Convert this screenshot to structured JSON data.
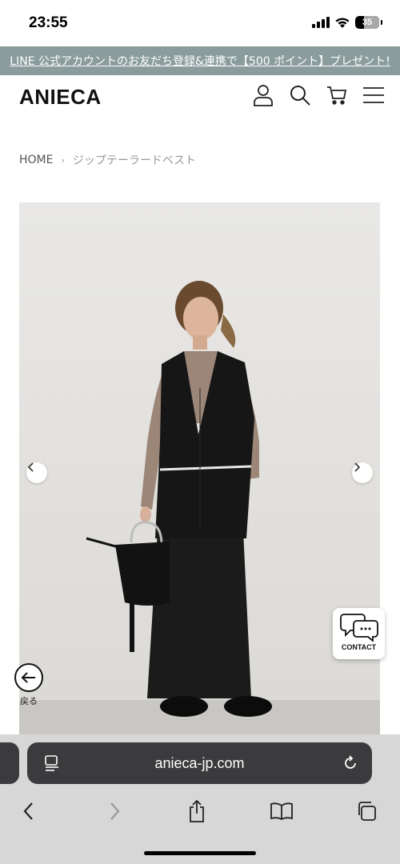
{
  "status_bar": {
    "time": "23:55",
    "battery_level": "35"
  },
  "promo_banner": {
    "text": "LINE 公式アカウントのお友だち登録&連携で【500 ポイント】プレゼント!"
  },
  "header": {
    "brand": "ANIECA",
    "icons": [
      "account-icon",
      "search-icon",
      "cart-icon",
      "menu-icon"
    ]
  },
  "breadcrumb": {
    "home": "HOME",
    "separator": "›",
    "current": "ジップテーラードベスト"
  },
  "product": {
    "image_alt": "ジップテーラードベスト model photo",
    "carousel_prev": "‹",
    "carousel_next": "›"
  },
  "contact": {
    "label": "CONTACT"
  },
  "back": {
    "label": "戻る"
  },
  "browser": {
    "url": "anieca-jp.com"
  },
  "colors": {
    "banner": "#8a9c9c",
    "browser_bar": "#3b3b3d",
    "browser_bg": "#d7d7d7"
  }
}
